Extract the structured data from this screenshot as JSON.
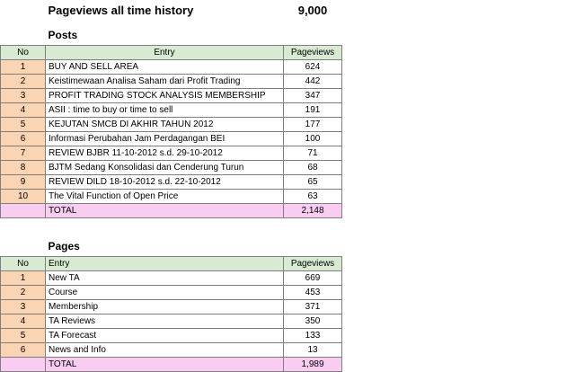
{
  "summary": {
    "label": "Pageviews all time history",
    "value": "9,000"
  },
  "posts": {
    "title": "Posts",
    "headers": {
      "no": "No",
      "entry": "Entry",
      "pageviews": "Pageviews"
    },
    "rows": [
      {
        "no": "1",
        "entry": "BUY AND SELL AREA",
        "pageviews": "624"
      },
      {
        "no": "2",
        "entry": "Keistimewaan Analisa Saham dari Profit Trading",
        "pageviews": "442"
      },
      {
        "no": "3",
        "entry": "PROFIT TRADING STOCK ANALYSIS MEMBERSHIP",
        "pageviews": "347"
      },
      {
        "no": "4",
        "entry": "ASII : time to buy or time to sell",
        "pageviews": "191"
      },
      {
        "no": "5",
        "entry": "KEJUTAN SMCB DI AKHIR TAHUN 2012",
        "pageviews": "177"
      },
      {
        "no": "6",
        "entry": "Informasi Perubahan Jam Perdagangan BEI",
        "pageviews": "100"
      },
      {
        "no": "7",
        "entry": "REVIEW BJBR 11-10-2012 s.d. 29-10-2012",
        "pageviews": "71"
      },
      {
        "no": "8",
        "entry": "BJTM Sedang Konsolidasi dan Cenderung Turun",
        "pageviews": "68"
      },
      {
        "no": "9",
        "entry": "REVIEW DILD 18-10-2012 s.d. 22-10-2012",
        "pageviews": "65"
      },
      {
        "no": "10",
        "entry": "The Vital Function of Open Price",
        "pageviews": "63"
      }
    ],
    "total": {
      "label": "TOTAL",
      "value": "2,148"
    }
  },
  "pages": {
    "title": "Pages",
    "headers": {
      "no": "No",
      "entry": "Entry",
      "pageviews": "Pageviews"
    },
    "rows": [
      {
        "no": "1",
        "entry": "New TA",
        "pageviews": "669"
      },
      {
        "no": "2",
        "entry": "Course",
        "pageviews": "453"
      },
      {
        "no": "3",
        "entry": "Membership",
        "pageviews": "371"
      },
      {
        "no": "4",
        "entry": "TA Reviews",
        "pageviews": "350"
      },
      {
        "no": "5",
        "entry": "TA Forecast",
        "pageviews": "133"
      },
      {
        "no": "6",
        "entry": "News and Info",
        "pageviews": "13"
      }
    ],
    "total": {
      "label": "TOTAL",
      "value": "1,989"
    }
  },
  "colors": {
    "header_bg": "#d9ead3",
    "number_bg": "#fbd4b4",
    "total_bg": "#f9ccf2",
    "grid": "#7f7f7f"
  }
}
